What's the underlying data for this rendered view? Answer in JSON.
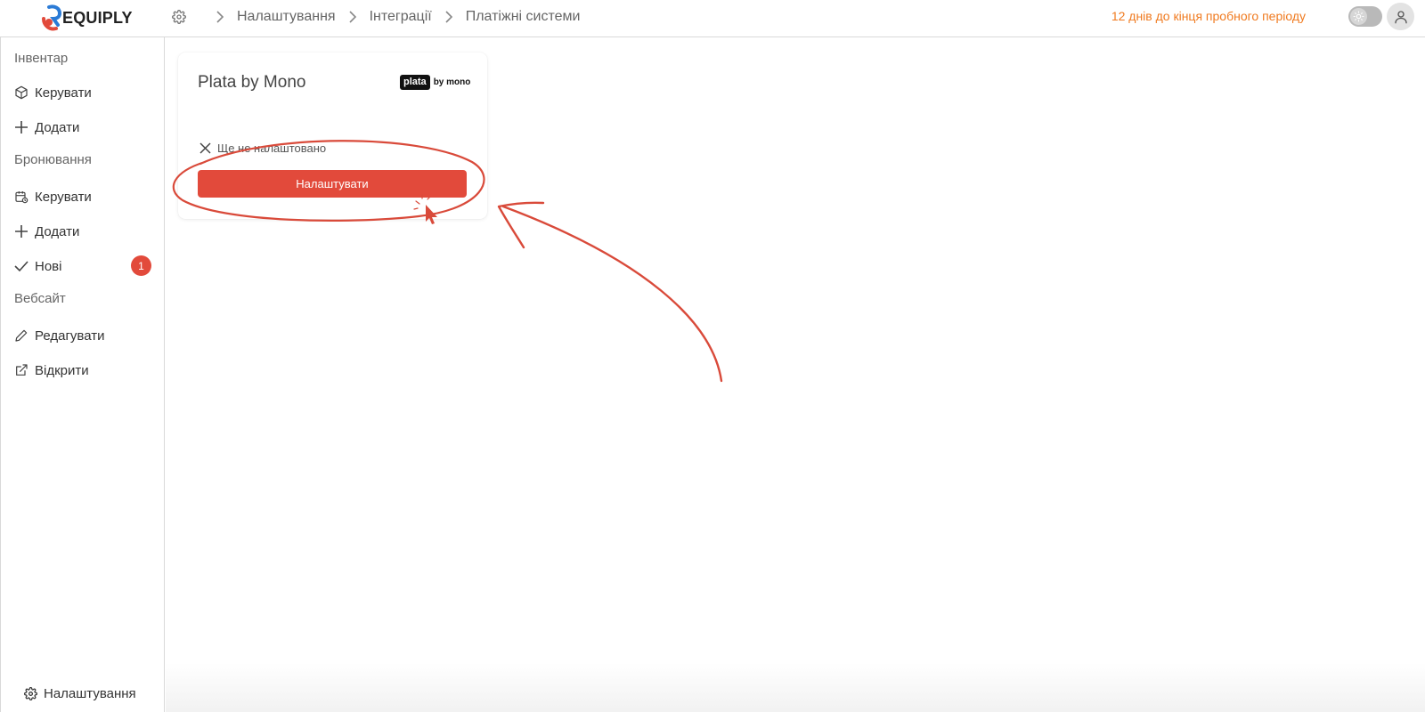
{
  "app": {
    "logo_text": "EQUIPLY",
    "trial_notice": "12 днів до кінця пробного періоду"
  },
  "breadcrumb": {
    "items": [
      "Налаштування",
      "Інтеграції",
      "Платіжні системи"
    ]
  },
  "sidebar": {
    "sections": [
      {
        "title": "Інвентар",
        "items": [
          {
            "label": "Керувати",
            "icon": "box-icon"
          },
          {
            "label": "Додати",
            "icon": "plus-icon"
          }
        ]
      },
      {
        "title": "Бронювання",
        "items": [
          {
            "label": "Керувати",
            "icon": "calendar-icon"
          },
          {
            "label": "Додати",
            "icon": "plus-icon"
          },
          {
            "label": "Нові",
            "icon": "check-icon",
            "badge": "1"
          }
        ]
      },
      {
        "title": "Вебсайт",
        "items": [
          {
            "label": "Редагувати",
            "icon": "pencil-icon"
          },
          {
            "label": "Відкрити",
            "icon": "external-link-icon"
          }
        ]
      }
    ],
    "footer_label": "Налаштування"
  },
  "integration_card": {
    "title": "Plata by Mono",
    "logo_box_text": "plata",
    "logo_suffix_text": "by mono",
    "status_text": "Ще не налаштовано",
    "button_label": "Налаштувати"
  },
  "colors": {
    "accent": "#e24a3b",
    "trial_text": "#f07a1f",
    "annotation": "#d94a3a"
  }
}
